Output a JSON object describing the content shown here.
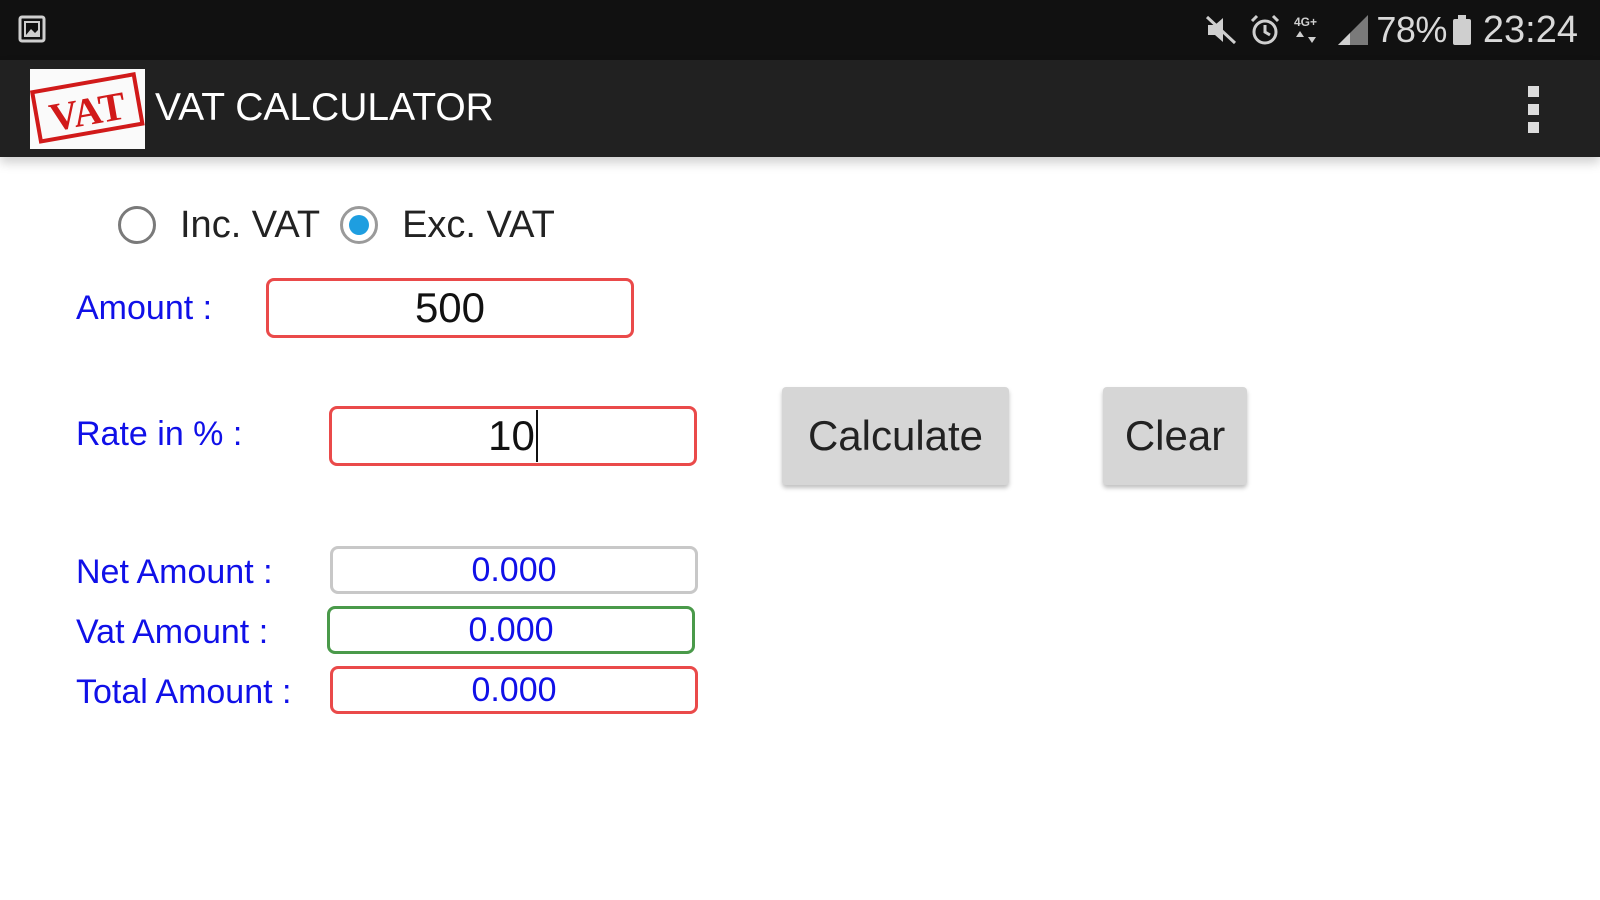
{
  "status_bar": {
    "left_icon": "gallery-icon",
    "icons": [
      "mute-icon",
      "alarm-icon",
      "network-4g-icon",
      "signal-icon"
    ],
    "battery_percent": "78%",
    "battery_icon": "battery-icon",
    "time": "23:24"
  },
  "action_bar": {
    "logo_text": "VAT",
    "title": "VAT CALCULATOR",
    "menu_icon": "overflow-menu-icon"
  },
  "mode": {
    "options": [
      {
        "label": "Inc. VAT",
        "checked": false
      },
      {
        "label": "Exc. VAT",
        "checked": true
      }
    ]
  },
  "form": {
    "amount_label": "Amount :",
    "amount_value": "500",
    "rate_label": "Rate in % :",
    "rate_value": "10",
    "calculate_label": "Calculate",
    "clear_label": "Clear"
  },
  "results": {
    "net_label": "Net Amount :",
    "net_value": "0.000",
    "vat_label": "Vat Amount :",
    "vat_value": "0.000",
    "total_label": "Total Amount :",
    "total_value": "0.000"
  },
  "colors": {
    "label_blue": "#1010e8",
    "radio_accent": "#1e9ee0",
    "border_red": "#ea4a4a",
    "border_green": "#4a9a4a",
    "toolbar": "#212121"
  }
}
